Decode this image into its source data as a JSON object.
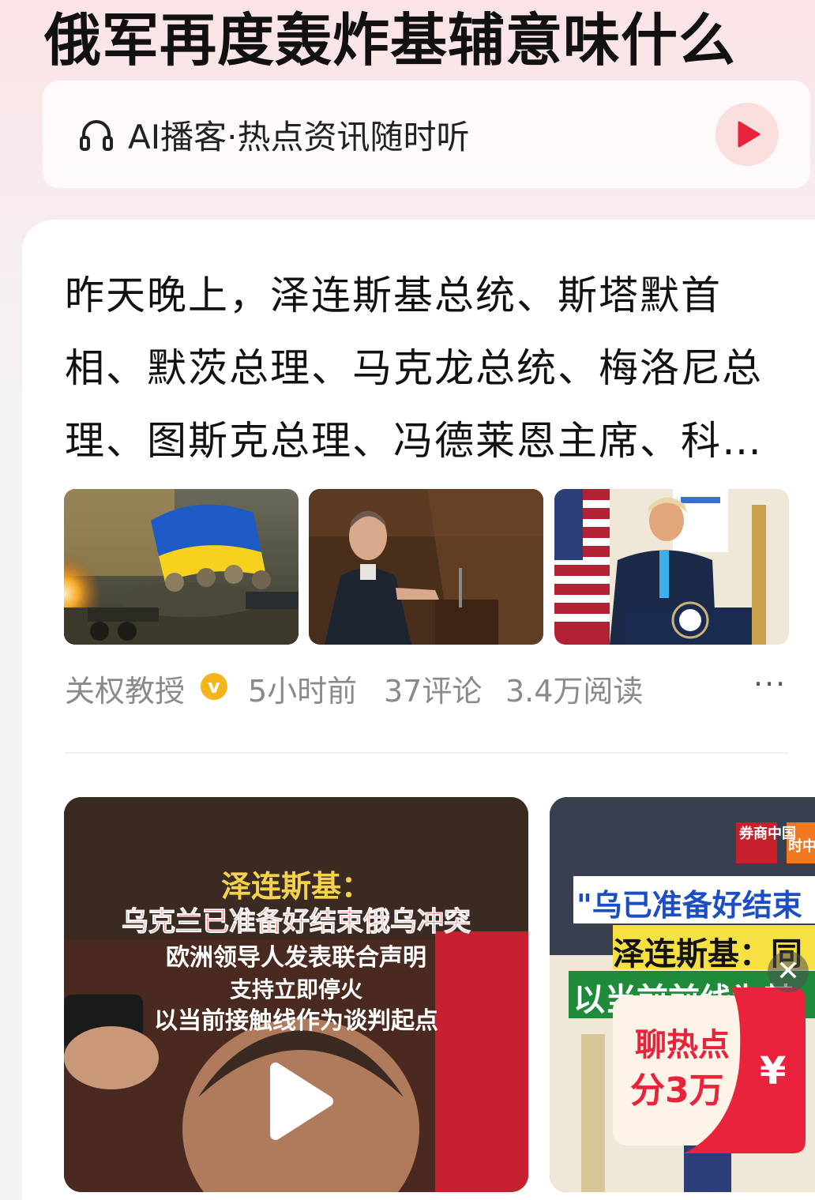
{
  "headline": "俄军再度轰炸基辅意味什么",
  "podcast": {
    "icon": "headphones-icon",
    "label": "AI播客·热点资讯随时听",
    "play_icon": "play-icon"
  },
  "article": {
    "text": "昨天晚上，泽连斯基总统、斯塔默首相、默茨总理、马克龙总统、梅洛尼总理、图斯克总理、冯德莱恩主席、科…",
    "images": [
      "ukraine-soldiers-flag-photo",
      "macron-speaking-photo",
      "trump-podium-photo"
    ],
    "author": "关权教授",
    "verified_icon": "verified-badge-icon",
    "verified_mark": "v",
    "time": "5小时前",
    "comments": "37评论",
    "reads": "3.4万阅读",
    "more": "···"
  },
  "video_1": {
    "title": "泽连斯基：",
    "subtitle": "乌克兰已准备好结束俄乌冲突",
    "line3": "欧洲领导人发表联合声明",
    "line4": "支持立即停火",
    "line5": "以当前接触线作为谈判起点"
  },
  "video_2": {
    "logo": "券商中国",
    "logo2": "时中",
    "title": "\"乌已准备好结束",
    "line2": "泽连斯基：同",
    "line3": "以当前前线为基"
  },
  "promo": {
    "line1": "聊热点",
    "line2": "分3万",
    "yuan": "¥",
    "close": "✕"
  },
  "colors": {
    "accent": "#e8233b",
    "meta": "#8a8a8a",
    "verified": "#f3b51b"
  }
}
